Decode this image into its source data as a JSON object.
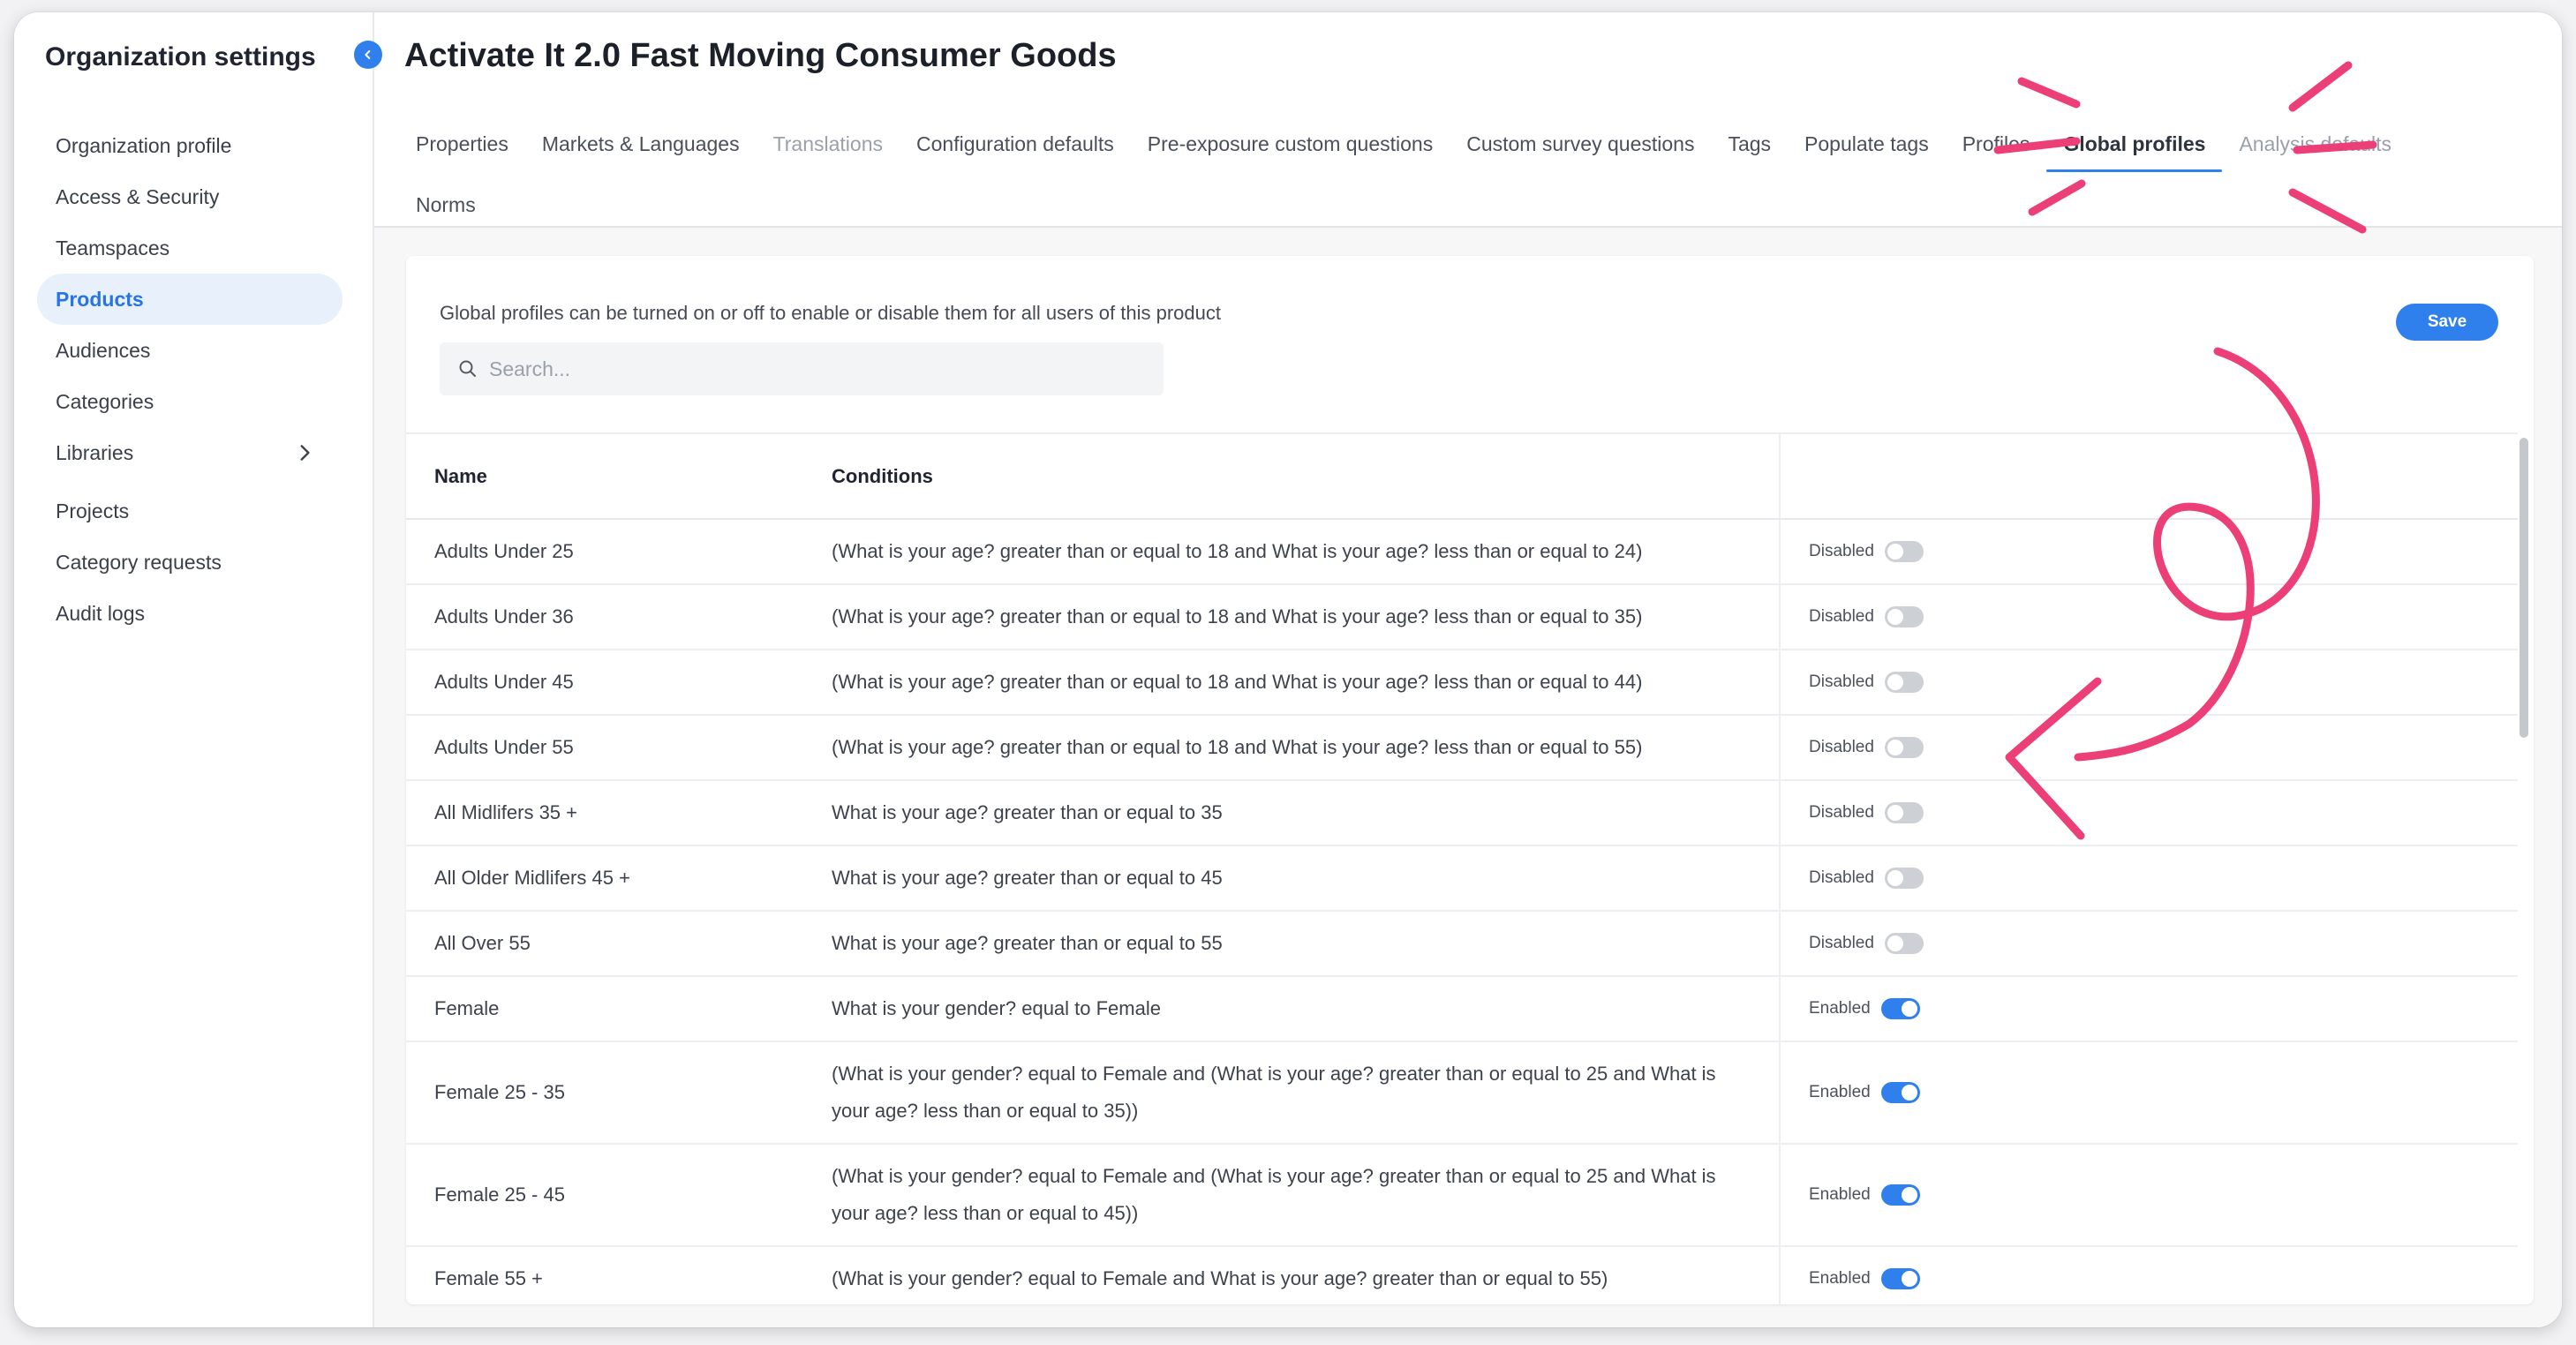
{
  "sidebar": {
    "title": "Organization settings",
    "items": [
      {
        "label": "Organization profile"
      },
      {
        "label": "Access & Security"
      },
      {
        "label": "Teamspaces"
      },
      {
        "label": "Products"
      },
      {
        "label": "Audiences"
      },
      {
        "label": "Categories"
      },
      {
        "label": "Libraries"
      },
      {
        "label": "Projects"
      },
      {
        "label": "Category requests"
      },
      {
        "label": "Audit logs"
      }
    ]
  },
  "header": {
    "title": "Activate It 2.0 Fast Moving Consumer Goods",
    "tabs": [
      {
        "label": "Properties"
      },
      {
        "label": "Markets & Languages"
      },
      {
        "label": "Translations"
      },
      {
        "label": "Configuration defaults"
      },
      {
        "label": "Pre-exposure custom questions"
      },
      {
        "label": "Custom survey questions"
      },
      {
        "label": "Tags"
      },
      {
        "label": "Populate tags"
      },
      {
        "label": "Profiles"
      },
      {
        "label": "Global profiles"
      },
      {
        "label": "Analysis defaults"
      },
      {
        "label": "Norms"
      }
    ]
  },
  "content": {
    "helper_text": "Global profiles can be turned on or off to enable or disable them for all users of this product",
    "search_placeholder": "Search...",
    "save_label": "Save",
    "columns": {
      "name": "Name",
      "conditions": "Conditions"
    },
    "rows": [
      {
        "name": "Adults Under 25",
        "conditions": "(What is your age? greater than or equal to 18 and What is your age? less than or equal to 24)",
        "status": "Disabled"
      },
      {
        "name": "Adults Under 36",
        "conditions": "(What is your age? greater than or equal to 18 and What is your age? less than or equal to 35)",
        "status": "Disabled"
      },
      {
        "name": "Adults Under 45",
        "conditions": "(What is your age? greater than or equal to 18 and What is your age? less than or equal to 44)",
        "status": "Disabled"
      },
      {
        "name": "Adults Under 55",
        "conditions": "(What is your age? greater than or equal to 18 and What is your age? less than or equal to 55)",
        "status": "Disabled"
      },
      {
        "name": "All Midlifers 35 +",
        "conditions": "What is your age? greater than or equal to 35",
        "status": "Disabled"
      },
      {
        "name": "All Older Midlifers 45 +",
        "conditions": "What is your age? greater than or equal to 45",
        "status": "Disabled"
      },
      {
        "name": "All Over 55",
        "conditions": "What is your age? greater than or equal to 55",
        "status": "Disabled"
      },
      {
        "name": "Female",
        "conditions": "What is your gender? equal to Female",
        "status": "Enabled"
      },
      {
        "name": "Female 25 - 35",
        "conditions": "(What is your gender? equal to Female and (What is your age? greater than or equal to 25 and What is your age? less than or equal to 35))",
        "status": "Enabled"
      },
      {
        "name": "Female 25 - 45",
        "conditions": "(What is your gender? equal to Female and (What is your age? greater than or equal to 25 and What is your age? less than or equal to 45))",
        "status": "Enabled"
      },
      {
        "name": "Female 55 +",
        "conditions": "(What is your gender? equal to Female and What is your age? greater than or equal to 55)",
        "status": "Enabled"
      }
    ]
  },
  "colors": {
    "accent": "#2f80ed",
    "annotation": "#ec3f77"
  }
}
